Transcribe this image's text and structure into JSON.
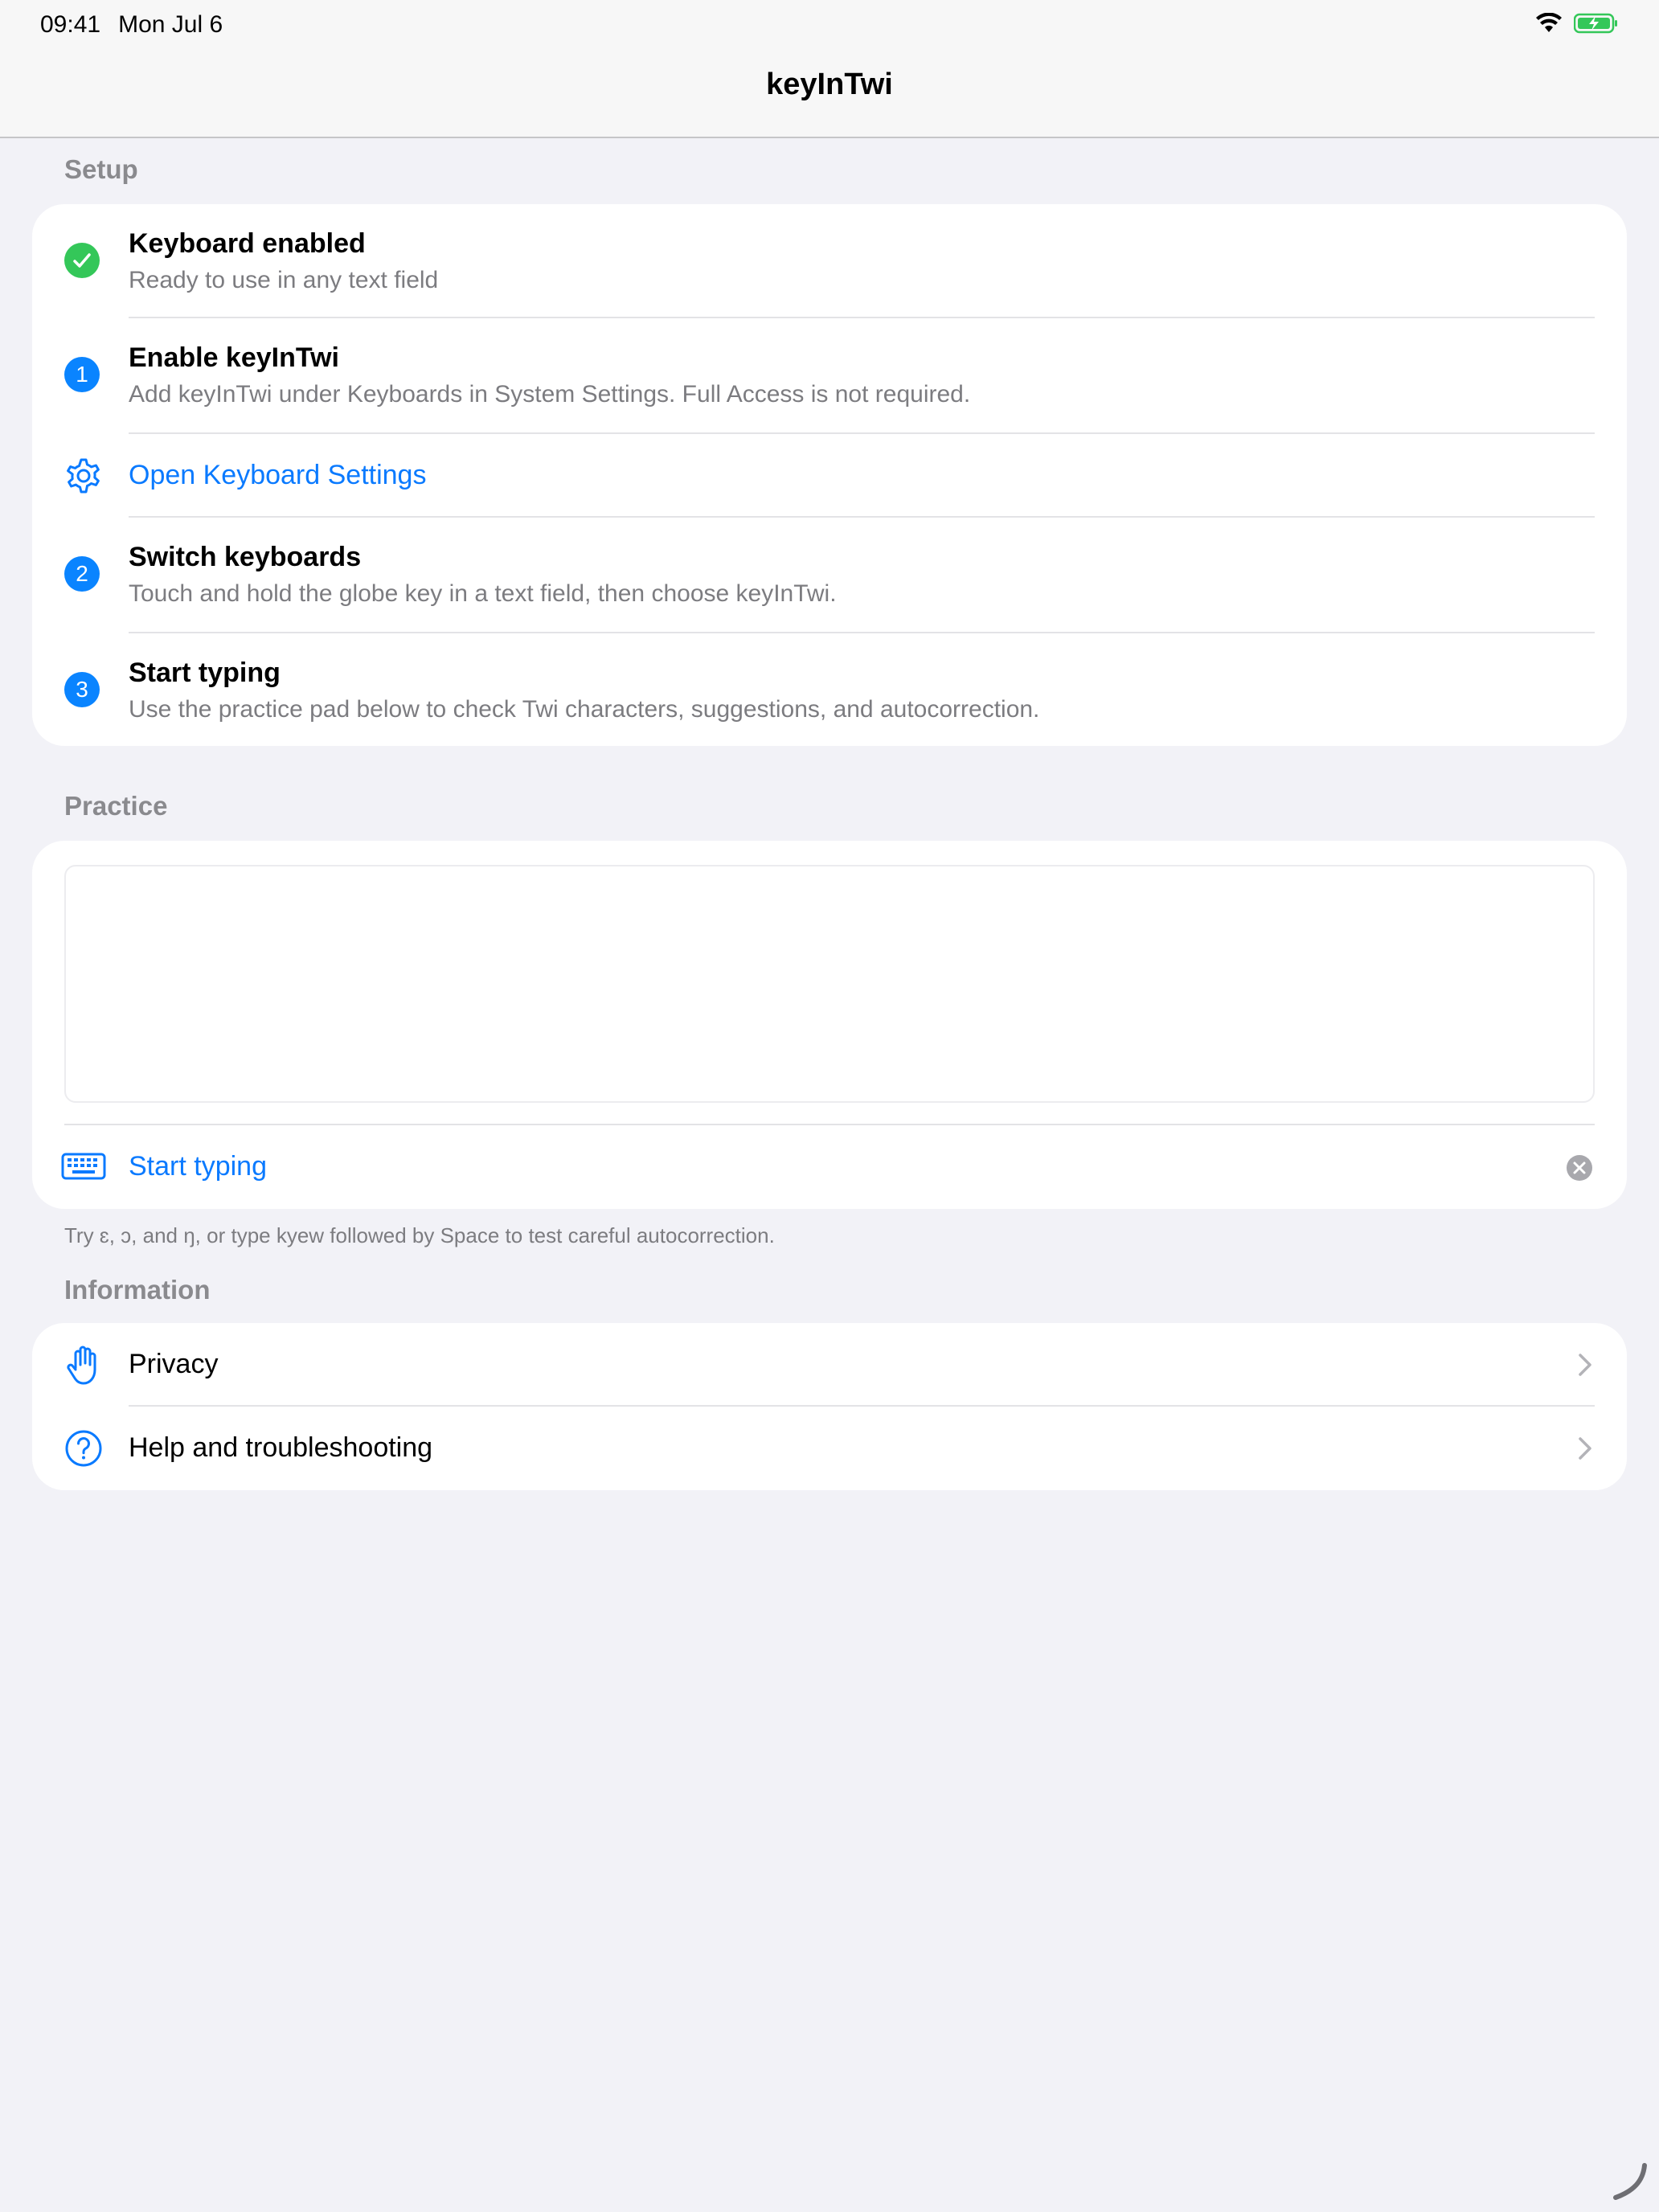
{
  "status": {
    "time": "09:41",
    "date": "Mon Jul 6"
  },
  "nav": {
    "title": "keyInTwi"
  },
  "setup": {
    "header": "Setup",
    "rows": [
      {
        "title": "Keyboard enabled",
        "subtitle": "Ready to use in any text field",
        "icon": "checkmark-circle-icon"
      },
      {
        "badge": "1",
        "title": "Enable keyInTwi",
        "subtitle": "Add keyInTwi under Keyboards in System Settings. Full Access is not required."
      },
      {
        "link": "Open Keyboard Settings",
        "icon": "gear-icon"
      },
      {
        "badge": "2",
        "title": "Switch keyboards",
        "subtitle": "Touch and hold the globe key in a text field, then choose keyInTwi."
      },
      {
        "badge": "3",
        "title": "Start typing",
        "subtitle": "Use the practice pad below to check Twi characters, suggestions, and autocorrection."
      }
    ]
  },
  "practice": {
    "header": "Practice",
    "text": "",
    "action_label": "Start typing",
    "footnote": "Try ɛ, ɔ, and ŋ, or type kyew followed by Space to test careful autocorrection."
  },
  "information": {
    "header": "Information",
    "rows": [
      {
        "label": "Privacy",
        "icon": "hand-icon"
      },
      {
        "label": "Help and troubleshooting",
        "icon": "question-circle-icon"
      }
    ]
  },
  "colors": {
    "accent": "#0a7aff",
    "success": "#34c759",
    "background": "#f2f2f7"
  }
}
